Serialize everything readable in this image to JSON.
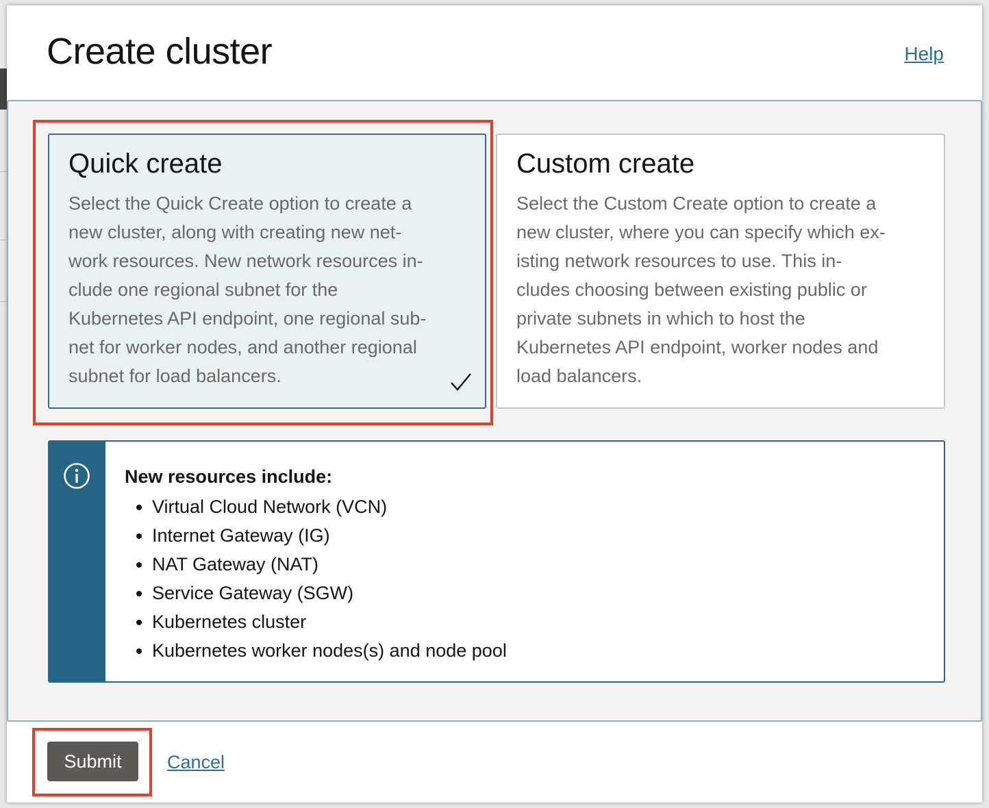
{
  "dialog": {
    "title": "Create cluster",
    "help_label": "Help"
  },
  "options": [
    {
      "title": "Quick create",
      "description_lines": [
        "Select the Quick Create option to create a",
        "new cluster, along with creating new net-",
        "work resources. New network resources in-",
        "clude one regional subnet for the",
        "Kubernetes API endpoint, one regional sub-",
        "net for worker nodes, and another regional",
        "subnet for load balancers."
      ],
      "selected": true
    },
    {
      "title": "Custom create",
      "description_lines": [
        "Select the Custom Create option to create a",
        "new cluster, where you can specify which ex-",
        "isting network resources to use. This in-",
        "cludes choosing between existing public or",
        "private subnets in which to host the",
        "Kubernetes API endpoint, worker nodes and",
        "load balancers."
      ],
      "selected": false
    }
  ],
  "info": {
    "heading": "New resources include:",
    "items": [
      "Virtual Cloud Network (VCN)",
      "Internet Gateway (IG)",
      "NAT Gateway (NAT)",
      "Service Gateway (SGW)",
      "Kubernetes cluster",
      "Kubernetes worker nodes(s) and node pool"
    ],
    "icon": "info-icon"
  },
  "footer": {
    "submit_label": "Submit",
    "cancel_label": "Cancel"
  },
  "colors": {
    "highlight": "#e0412b",
    "info_accent": "#266586",
    "link": "#2a6f97",
    "submit_bg": "#5c5955"
  }
}
